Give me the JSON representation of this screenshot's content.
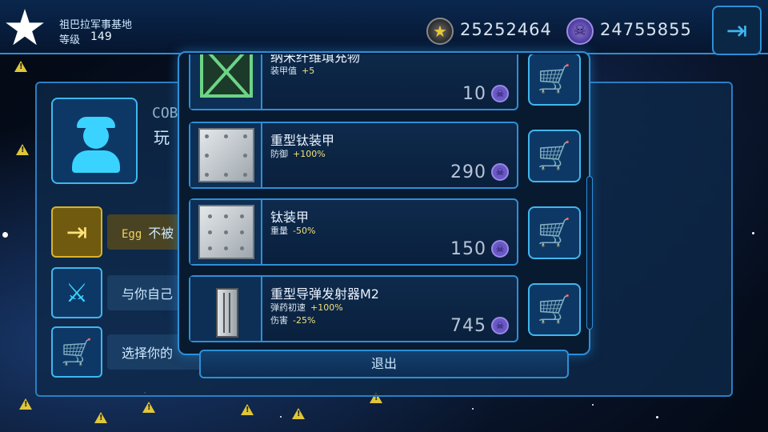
{
  "topbar": {
    "base_name": "祖巴拉军事基地",
    "level_label": "等级",
    "level_value": "149",
    "gold_amount": "25252464",
    "skull_amount": "24755855"
  },
  "player": {
    "code": "COB",
    "name": "玩"
  },
  "side_menu": [
    {
      "tag": "Egg",
      "label": "不被"
    },
    {
      "label": "与你自己"
    },
    {
      "label": "选择你的"
    }
  ],
  "shop": {
    "items": [
      {
        "name": "纳米纤维填充物",
        "stats": [
          {
            "label": "装甲值",
            "value": "+5"
          }
        ],
        "price": "10"
      },
      {
        "name": "重型钛装甲",
        "stats": [
          {
            "label": "防御",
            "value": "+100%"
          }
        ],
        "price": "290"
      },
      {
        "name": "钛装甲",
        "stats": [
          {
            "label": "重量",
            "value": "-50%"
          }
        ],
        "price": "150"
      },
      {
        "name": "重型导弹发射器M2",
        "stats": [
          {
            "label": "弹药初速",
            "value": "+100%"
          },
          {
            "label": "伤害",
            "value": "-25%"
          }
        ],
        "price": "745"
      }
    ],
    "exit_label": "退出"
  },
  "icons": {
    "gold": "star-coin-icon",
    "skull": "skull-coin-icon",
    "cart": "shopping-cart-icon",
    "exit": "exit-icon"
  },
  "colors": {
    "accent": "#2e8fd6",
    "cyan": "#3ad3ff",
    "stat_value": "#f2e27a",
    "warning": "#e0c63a"
  }
}
